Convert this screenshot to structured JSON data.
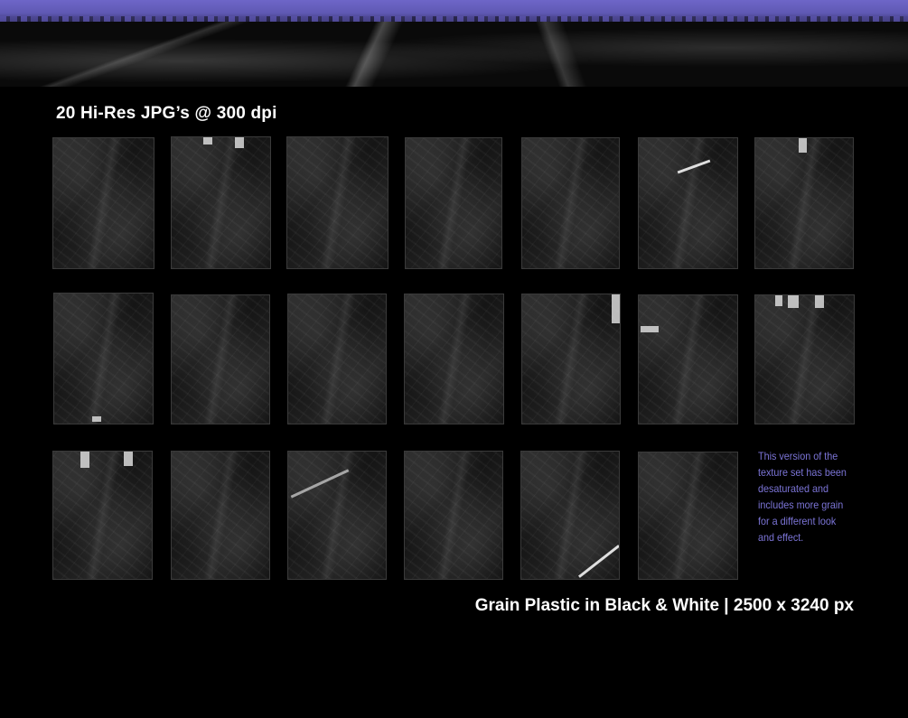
{
  "heading": "20 Hi-Res JPG’s @ 300 dpi",
  "description": "This version of the texture set has been desaturated and includes more grain for a different look and effect.",
  "footer_caption": "Grain Plastic in Black & White | 2500 x 3240 px",
  "colors": {
    "background": "#000000",
    "banner_purple": "#6e66c8",
    "description_text": "#7b74d6",
    "heading_text": "#ffffff"
  },
  "thumbnail_count": 20
}
